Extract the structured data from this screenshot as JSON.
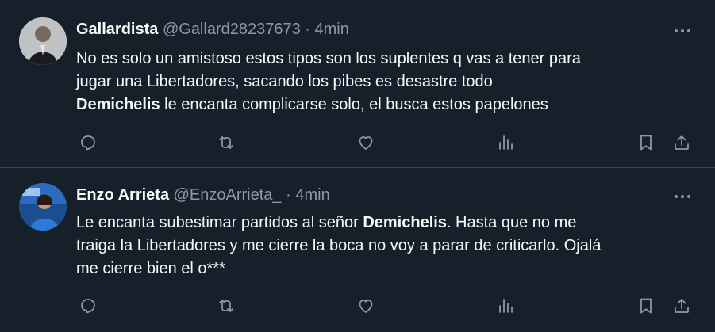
{
  "colors": {
    "background": "#15202b",
    "text": "#f7f9f9",
    "muted": "#8b98a5",
    "divider": "#38444d"
  },
  "tweets": [
    {
      "name": "Gallardista",
      "handle": "@Gallard28237673",
      "dot": "·",
      "time": "4min",
      "more_icon": "more-horizontal-icon",
      "text_parts": [
        "No es solo un amistoso estos tipos son los suplentes q vas a tener para",
        "jugar una Libertadores, sacando los pibes es desastre todo",
        "Demichelis",
        " le encanta complicarse solo, el busca estos papelones"
      ],
      "action_icons": [
        "reply-icon",
        "retweet-icon",
        "like-icon",
        "views-icon",
        "bookmark-icon",
        "share-icon"
      ]
    },
    {
      "name": "Enzo Arrieta",
      "handle": "@EnzoArrieta_",
      "dot": "·",
      "time": "4min",
      "more_icon": "more-horizontal-icon",
      "text_parts": [
        "Le encanta subestimar partidos al señor ",
        "Demichelis",
        ". Hasta que no me",
        "traiga la Libertadores y me cierre la boca no voy a parar de criticarlo. Ojalá",
        "me cierre bien el o***"
      ],
      "action_icons": [
        "reply-icon",
        "retweet-icon",
        "like-icon",
        "views-icon",
        "bookmark-icon",
        "share-icon"
      ]
    }
  ]
}
